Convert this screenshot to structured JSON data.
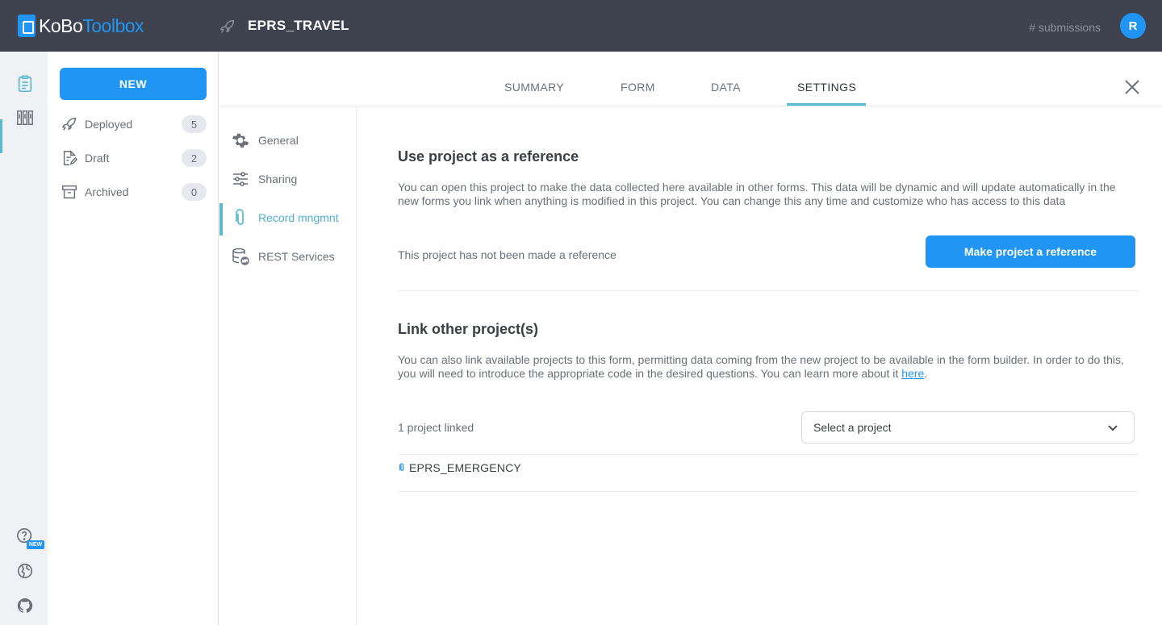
{
  "header": {
    "logo_part1": "KoBo",
    "logo_part2": "Toolbox",
    "project_title": "EPRS_TRAVEL",
    "submissions_label": "# submissions",
    "avatar_initial": "R"
  },
  "sidebar": {
    "new_button": "NEW",
    "items": [
      {
        "label": "Deployed",
        "count": "5",
        "icon": "rocket-icon"
      },
      {
        "label": "Draft",
        "count": "2",
        "icon": "draft-icon"
      },
      {
        "label": "Archived",
        "count": "0",
        "icon": "archive-icon"
      }
    ]
  },
  "rail": {
    "new_badge": "NEW"
  },
  "tabs": [
    {
      "label": "SUMMARY"
    },
    {
      "label": "FORM"
    },
    {
      "label": "DATA"
    },
    {
      "label": "SETTINGS",
      "active": true
    }
  ],
  "subnav": [
    {
      "label": "General",
      "icon": "gear-icon"
    },
    {
      "label": "Sharing",
      "icon": "sliders-icon"
    },
    {
      "label": "Record mngmnt",
      "icon": "paperclip-icon",
      "active": true
    },
    {
      "label": "REST Services",
      "icon": "database-sync-icon"
    }
  ],
  "content": {
    "reference_title": "Use project as a reference",
    "reference_desc": "You can open this project to make the data collected here available in other forms. This data will be dynamic and will update automatically in the new forms you link when anything is modified in this project. You can change this any time and customize who has access to this data",
    "reference_status": "This project has not been made a reference",
    "reference_button": "Make project a reference",
    "link_title": "Link other project(s)",
    "link_desc": "You can also link available projects to this form, permitting data coming from the new project to be available in the form builder. In order to do this, you will need to introduce the appropriate code in the desired questions. You can learn more about it",
    "link_here": "here",
    "link_period": ".",
    "linked_count": "1 project linked",
    "select_placeholder": "Select a project",
    "linked_projects": [
      "EPRS_EMERGENCY"
    ]
  },
  "colors": {
    "header_bg": "#3f434f",
    "primary": "#2095f3",
    "accent_teal": "#5ab9cf"
  }
}
